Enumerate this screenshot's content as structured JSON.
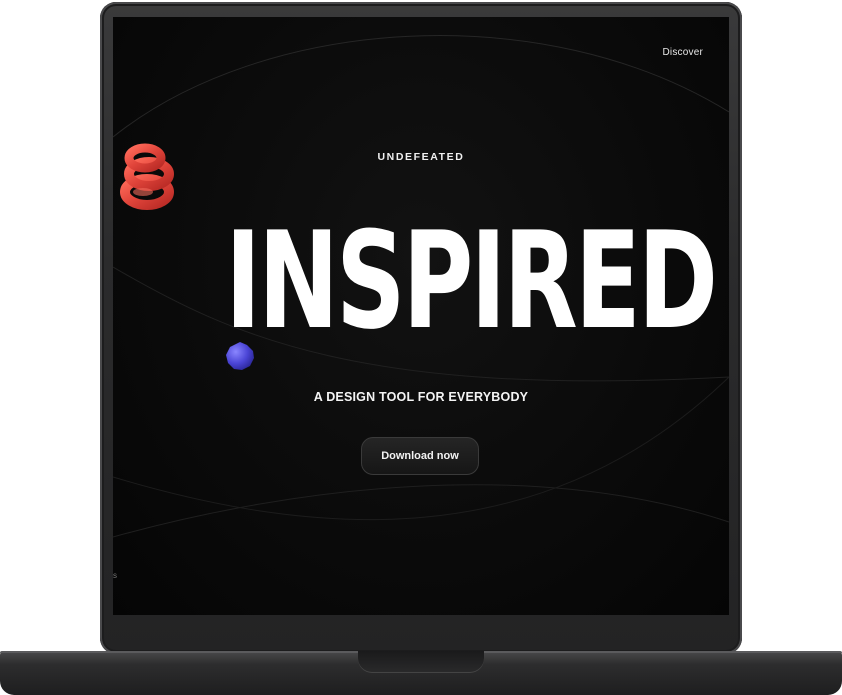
{
  "nav": {
    "discover_label": "Discover"
  },
  "hero": {
    "eyebrow": "UNDEFEATED",
    "headline": "INSPIRED",
    "tagline": "A DESIGN TOOL FOR EVERYBODY",
    "cta_label": "Download now"
  },
  "edge": {
    "right_glyph": "⋮",
    "left_glyph": "s"
  },
  "icons": {
    "spiral": "red-spiral-3d-icon",
    "blob": "blue-sphere-3d-icon"
  },
  "colors": {
    "screen_background": "#0a0a0a",
    "text_primary": "#ffffff",
    "spiral_red": "#e0443a",
    "blob_blue": "#4b45d6",
    "device_frame": "#2b2b2c"
  }
}
